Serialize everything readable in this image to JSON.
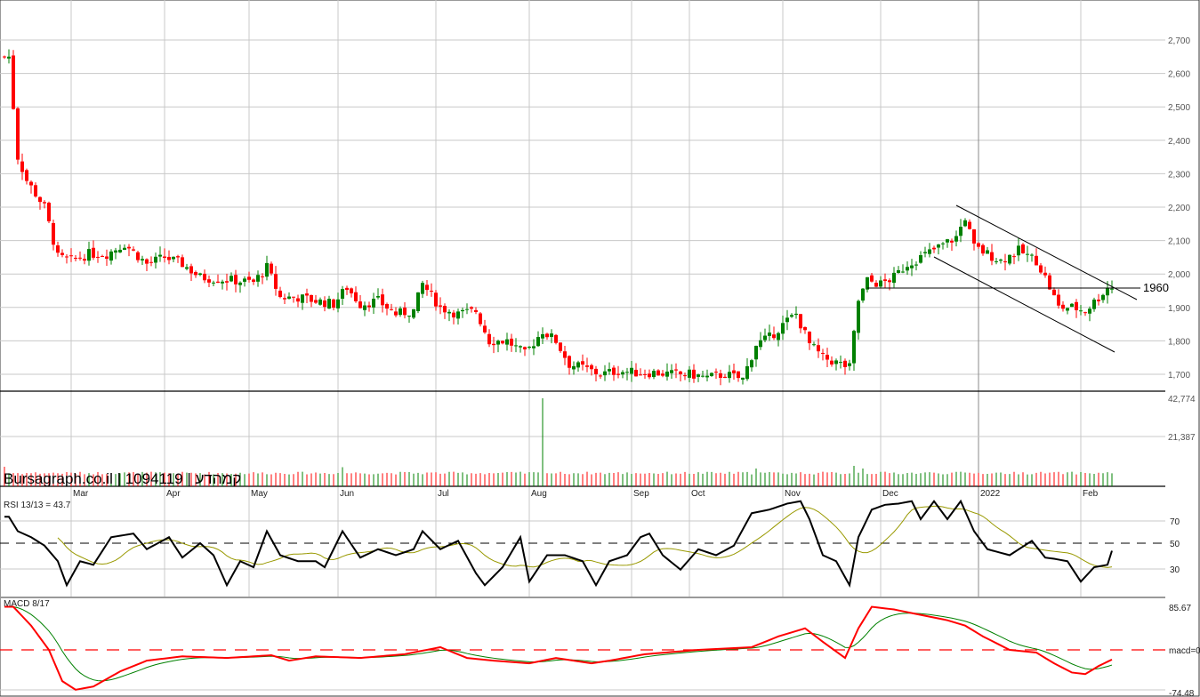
{
  "header": {
    "watermark": "Bursagraph.co.il | 1094119 | קמהדע"
  },
  "chart_data": [
    {
      "type": "candlestick",
      "title": "Bursagraph.co.il | 1094119 | קמהדע",
      "x_unit": "trading day index",
      "x_months": [
        {
          "label": "Mar",
          "day": 15
        },
        {
          "label": "Apr",
          "day": 36
        },
        {
          "label": "May",
          "day": 55
        },
        {
          "label": "Jun",
          "day": 75
        },
        {
          "label": "Jul",
          "day": 97
        },
        {
          "label": "Aug",
          "day": 118
        },
        {
          "label": "Sep",
          "day": 141
        },
        {
          "label": "Oct",
          "day": 154
        },
        {
          "label": "Nov",
          "day": 175
        },
        {
          "label": "Dec",
          "day": 197
        },
        {
          "label": "2022",
          "day": 219
        },
        {
          "label": "Feb",
          "day": 242
        }
      ],
      "y_ticks": [
        "1,700",
        "1,800",
        "1,900",
        "2,000",
        "2,100",
        "2,200",
        "2,300",
        "2,400",
        "2,500",
        "2,600",
        "2,700"
      ],
      "ylim": [
        1650,
        2800
      ],
      "approx_closes": [
        [
          1,
          2650
        ],
        [
          3,
          2350
        ],
        [
          5,
          2280
        ],
        [
          9,
          2200
        ],
        [
          12,
          2050
        ],
        [
          15,
          2040
        ],
        [
          19,
          2060
        ],
        [
          23,
          2060
        ],
        [
          27,
          2090
        ],
        [
          32,
          2030
        ],
        [
          36,
          2050
        ],
        [
          40,
          2030
        ],
        [
          44,
          1990
        ],
        [
          48,
          1985
        ],
        [
          52,
          1980
        ],
        [
          56,
          1975
        ],
        [
          59,
          2020
        ],
        [
          62,
          1930
        ],
        [
          66,
          1930
        ],
        [
          70,
          1920
        ],
        [
          74,
          1910
        ],
        [
          77,
          1960
        ],
        [
          80,
          1910
        ],
        [
          84,
          1920
        ],
        [
          88,
          1880
        ],
        [
          92,
          1890
        ],
        [
          94,
          1970
        ],
        [
          98,
          1900
        ],
        [
          102,
          1880
        ],
        [
          106,
          1890
        ],
        [
          109,
          1800
        ],
        [
          113,
          1800
        ],
        [
          117,
          1760
        ],
        [
          121,
          1830
        ],
        [
          124,
          1800
        ],
        [
          127,
          1730
        ],
        [
          130,
          1720
        ],
        [
          134,
          1700
        ],
        [
          138,
          1710
        ],
        [
          142,
          1705
        ],
        [
          146,
          1705
        ],
        [
          150,
          1700
        ],
        [
          154,
          1700
        ],
        [
          158,
          1690
        ],
        [
          162,
          1700
        ],
        [
          166,
          1685
        ],
        [
          169,
          1790
        ],
        [
          172,
          1810
        ],
        [
          176,
          1860
        ],
        [
          178,
          1880
        ],
        [
          181,
          1790
        ],
        [
          184,
          1750
        ],
        [
          188,
          1730
        ],
        [
          190,
          1720
        ],
        [
          192,
          1920
        ],
        [
          194,
          1980
        ],
        [
          197,
          1970
        ],
        [
          200,
          1990
        ],
        [
          203,
          2030
        ],
        [
          206,
          2050
        ],
        [
          210,
          2080
        ],
        [
          214,
          2110
        ],
        [
          216,
          2170
        ],
        [
          218,
          2080
        ],
        [
          221,
          2060
        ],
        [
          224,
          2040
        ],
        [
          228,
          2070
        ],
        [
          232,
          2040
        ],
        [
          234,
          1990
        ],
        [
          237,
          1900
        ],
        [
          240,
          1900
        ],
        [
          243,
          1890
        ],
        [
          246,
          1930
        ],
        [
          248,
          1960
        ]
      ],
      "annotations": {
        "horizontal_level": "1960",
        "channel": "descending channel Dec–Feb"
      }
    },
    {
      "type": "bar",
      "name": "Volume",
      "y_ticks": [
        "21,387",
        "42,774"
      ],
      "ylim": [
        0,
        42774
      ],
      "spikes": [
        [
          0,
          4500
        ],
        [
          76,
          4200
        ],
        [
          121,
          42774
        ],
        [
          169,
          3500
        ],
        [
          191,
          5000
        ],
        [
          193,
          3500
        ]
      ]
    },
    {
      "type": "line",
      "label": "RSI 13/13 = 43.7",
      "y_ticks": [
        "30",
        "50",
        "70"
      ],
      "ylim": [
        0,
        100
      ],
      "dashed_level": 50,
      "rsi": [
        [
          1,
          72
        ],
        [
          3,
          60
        ],
        [
          6,
          55
        ],
        [
          9,
          48
        ],
        [
          12,
          35
        ],
        [
          14,
          15
        ],
        [
          17,
          35
        ],
        [
          20,
          32
        ],
        [
          24,
          55
        ],
        [
          29,
          58
        ],
        [
          32,
          45
        ],
        [
          37,
          55
        ],
        [
          40,
          38
        ],
        [
          44,
          50
        ],
        [
          47,
          40
        ],
        [
          50,
          15
        ],
        [
          53,
          35
        ],
        [
          56,
          30
        ],
        [
          59,
          60
        ],
        [
          62,
          40
        ],
        [
          66,
          35
        ],
        [
          70,
          35
        ],
        [
          72,
          30
        ],
        [
          76,
          60
        ],
        [
          80,
          38
        ],
        [
          84,
          45
        ],
        [
          88,
          40
        ],
        [
          92,
          45
        ],
        [
          94,
          60
        ],
        [
          98,
          45
        ],
        [
          102,
          52
        ],
        [
          106,
          25
        ],
        [
          108,
          15
        ],
        [
          112,
          30
        ],
        [
          116,
          55
        ],
        [
          118,
          18
        ],
        [
          122,
          40
        ],
        [
          126,
          40
        ],
        [
          130,
          35
        ],
        [
          133,
          15
        ],
        [
          136,
          35
        ],
        [
          140,
          40
        ],
        [
          143,
          55
        ],
        [
          145,
          58
        ],
        [
          148,
          40
        ],
        [
          152,
          28
        ],
        [
          156,
          45
        ],
        [
          160,
          40
        ],
        [
          164,
          48
        ],
        [
          168,
          75
        ],
        [
          172,
          78
        ],
        [
          176,
          83
        ],
        [
          179,
          85
        ],
        [
          181,
          70
        ],
        [
          184,
          40
        ],
        [
          187,
          35
        ],
        [
          190,
          15
        ],
        [
          192,
          55
        ],
        [
          195,
          78
        ],
        [
          198,
          82
        ],
        [
          201,
          83
        ],
        [
          204,
          85
        ],
        [
          206,
          70
        ],
        [
          209,
          85
        ],
        [
          212,
          70
        ],
        [
          215,
          85
        ],
        [
          218,
          60
        ],
        [
          221,
          45
        ],
        [
          226,
          40
        ],
        [
          231,
          52
        ],
        [
          234,
          38
        ],
        [
          236,
          37
        ],
        [
          239,
          35
        ],
        [
          242,
          18
        ],
        [
          245,
          30
        ],
        [
          248,
          32
        ],
        [
          249,
          43.7
        ]
      ]
    },
    {
      "type": "line",
      "label": "MACD 8/17",
      "y_ticks": [
        "85.67",
        "macd=0",
        "-74.48"
      ],
      "ylim": [
        -74.48,
        85.67
      ],
      "macd": [
        [
          2,
          80
        ],
        [
          6,
          45
        ],
        [
          10,
          0
        ],
        [
          13,
          -58
        ],
        [
          16,
          -74
        ],
        [
          20,
          -68
        ],
        [
          26,
          -40
        ],
        [
          32,
          -20
        ],
        [
          40,
          -12
        ],
        [
          50,
          -15
        ],
        [
          60,
          -10
        ],
        [
          64,
          -20
        ],
        [
          70,
          -12
        ],
        [
          80,
          -15
        ],
        [
          90,
          -8
        ],
        [
          98,
          5
        ],
        [
          104,
          -15
        ],
        [
          110,
          -20
        ],
        [
          118,
          -25
        ],
        [
          124,
          -15
        ],
        [
          132,
          -25
        ],
        [
          136,
          -20
        ],
        [
          144,
          -8
        ],
        [
          156,
          0
        ],
        [
          168,
          5
        ],
        [
          174,
          25
        ],
        [
          180,
          40
        ],
        [
          184,
          15
        ],
        [
          189,
          -15
        ],
        [
          192,
          40
        ],
        [
          195,
          80
        ],
        [
          200,
          75
        ],
        [
          206,
          65
        ],
        [
          212,
          55
        ],
        [
          216,
          45
        ],
        [
          220,
          25
        ],
        [
          226,
          0
        ],
        [
          232,
          -5
        ],
        [
          236,
          -25
        ],
        [
          240,
          -42
        ],
        [
          243,
          -45
        ],
        [
          246,
          -30
        ],
        [
          249,
          -18
        ]
      ]
    }
  ],
  "colors": {
    "up": "#008000",
    "down": "#ff0000",
    "rsi": "#000000",
    "rsi_signal": "#999900",
    "macd": "#ff0000",
    "macd_signal": "#008000",
    "grid": "#c8c8c8"
  }
}
